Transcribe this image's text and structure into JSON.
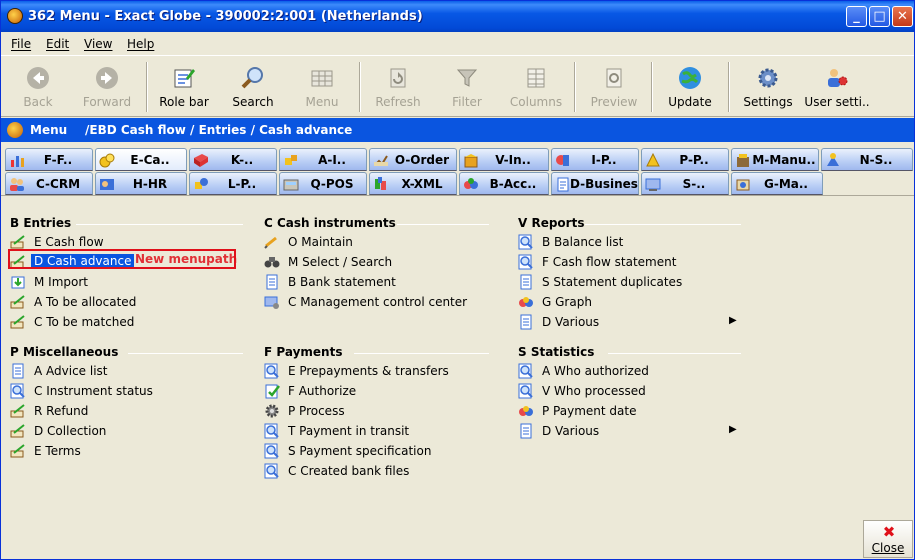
{
  "window": {
    "title": "362 Menu - Exact Globe - 390002:2:001 (Netherlands)",
    "min_glyph": "_",
    "max_glyph": "□",
    "close_glyph": "✕"
  },
  "menubar": [
    "File",
    "Edit",
    "View",
    "Help"
  ],
  "toolbar": {
    "back": "Back",
    "forward": "Forward",
    "role_bar": "Role bar",
    "search": "Search",
    "menu": "Menu",
    "refresh": "Refresh",
    "filter": "Filter",
    "columns": "Columns",
    "preview": "Preview",
    "update": "Update",
    "settings": "Settings",
    "user_settings": "User setti.."
  },
  "path": {
    "menu_label": "Menu",
    "breadcrumb": "/EBD  Cash flow / Entries / Cash advance"
  },
  "tabs_row1": [
    "F-F..",
    "E-Ca..",
    "K-..",
    "A-I..",
    "O-Order",
    "V-In..",
    "I-P..",
    "P-P..",
    "M-Manu..",
    "N-S.."
  ],
  "tabs_row2": [
    "C-CRM",
    "H-HR",
    "L-P..",
    "Q-POS",
    "X-XML",
    "B-Acc..",
    "D-Business",
    "S-..",
    "G-Ma.."
  ],
  "sections": {
    "entries": {
      "title": "B  Entries",
      "items": [
        "E  Cash flow",
        "D  Cash advance",
        "M  Import",
        "A  To be allocated",
        "C  To be matched"
      ]
    },
    "cash_instruments": {
      "title": "C  Cash instruments",
      "items": [
        "O  Maintain",
        "M  Select / Search",
        "B  Bank statement",
        "C  Management control center"
      ]
    },
    "reports": {
      "title": "V  Reports",
      "items": [
        "B  Balance list",
        "F  Cash flow statement",
        "S  Statement duplicates",
        "G  Graph",
        "D  Various"
      ]
    },
    "miscellaneous": {
      "title": "P  Miscellaneous",
      "items": [
        "A  Advice list",
        "C  Instrument status",
        "R  Refund",
        "D  Collection",
        "E  Terms"
      ]
    },
    "payments": {
      "title": "F  Payments",
      "items": [
        "E  Prepayments & transfers",
        "F  Authorize",
        "P  Process",
        "T  Payment in transit",
        "S  Payment specification",
        "C  Created bank files"
      ]
    },
    "statistics": {
      "title": "S  Statistics",
      "items": [
        "A  Who authorized",
        "V  Who processed",
        "P  Payment date",
        "D  Various"
      ]
    }
  },
  "submenu_arrow": "▶",
  "overlay_text": "New menupath",
  "close_button": {
    "icon": "✖",
    "label": "Close"
  }
}
